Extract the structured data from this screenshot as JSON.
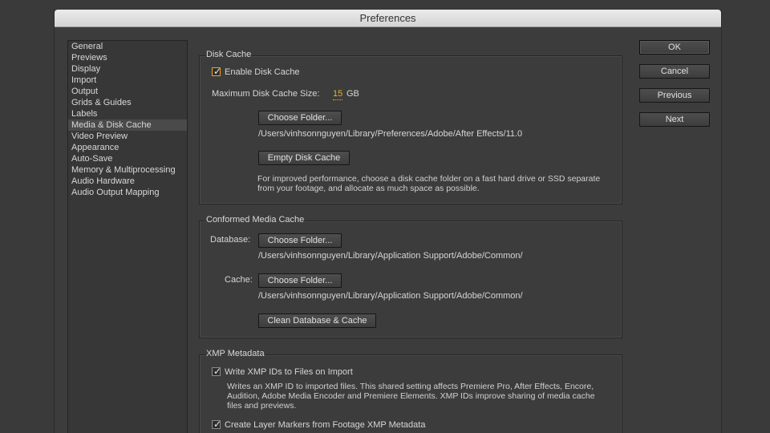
{
  "window": {
    "title": "Preferences"
  },
  "sidebar": {
    "items": [
      {
        "label": "General"
      },
      {
        "label": "Previews"
      },
      {
        "label": "Display"
      },
      {
        "label": "Import"
      },
      {
        "label": "Output"
      },
      {
        "label": "Grids & Guides"
      },
      {
        "label": "Labels"
      },
      {
        "label": "Media & Disk Cache",
        "selected": true
      },
      {
        "label": "Video Preview"
      },
      {
        "label": "Appearance"
      },
      {
        "label": "Auto-Save"
      },
      {
        "label": "Memory & Multiprocessing"
      },
      {
        "label": "Audio Hardware"
      },
      {
        "label": "Audio Output Mapping"
      }
    ]
  },
  "actions": {
    "ok": "OK",
    "cancel": "Cancel",
    "previous": "Previous",
    "next": "Next"
  },
  "disk_cache": {
    "title": "Disk Cache",
    "enable_label": "Enable Disk Cache",
    "enable_checked": true,
    "max_size_label": "Maximum Disk Cache Size:",
    "max_size_value": "15",
    "max_size_unit": "GB",
    "choose_folder": "Choose Folder...",
    "path": "/Users/vinhsonnguyen/Library/Preferences/Adobe/After Effects/11.0",
    "empty_button": "Empty Disk Cache",
    "description": "For improved performance, choose a disk cache folder on a fast hard drive or SSD separate from your footage, and allocate as much space as possible."
  },
  "conformed": {
    "title": "Conformed Media Cache",
    "database_label": "Database:",
    "database_button": "Choose Folder...",
    "database_path": "/Users/vinhsonnguyen/Library/Application Support/Adobe/Common/",
    "cache_label": "Cache:",
    "cache_button": "Choose Folder...",
    "cache_path": "/Users/vinhsonnguyen/Library/Application Support/Adobe/Common/",
    "clean_button": "Clean Database & Cache"
  },
  "xmp": {
    "title": "XMP Metadata",
    "write_label": "Write XMP IDs to Files on Import",
    "write_checked": true,
    "write_description": "Writes an XMP ID to imported files. This shared setting affects Premiere Pro, After Effects, Encore, Audition, Adobe Media Encoder and Premiere Elements. XMP IDs improve sharing of media cache files and previews.",
    "markers_label": "Create Layer Markers from Footage XMP Metadata",
    "markers_checked": true
  },
  "colors": {
    "accent": "#e8b220",
    "background": "#3c3c3c"
  }
}
